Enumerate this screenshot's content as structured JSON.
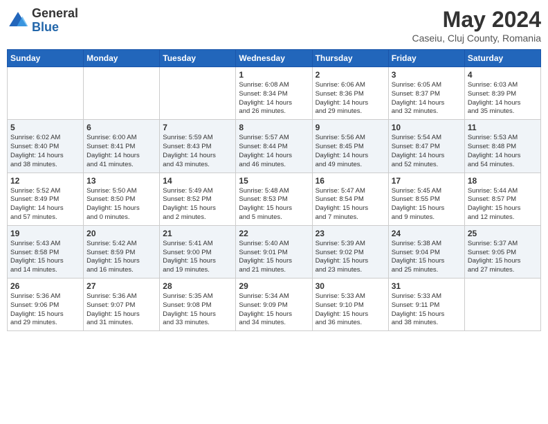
{
  "header": {
    "logo_general": "General",
    "logo_blue": "Blue",
    "main_title": "May 2024",
    "subtitle": "Caseiu, Cluj County, Romania"
  },
  "days_of_week": [
    "Sunday",
    "Monday",
    "Tuesday",
    "Wednesday",
    "Thursday",
    "Friday",
    "Saturday"
  ],
  "weeks": [
    [
      {
        "day": "",
        "info": ""
      },
      {
        "day": "",
        "info": ""
      },
      {
        "day": "",
        "info": ""
      },
      {
        "day": "1",
        "info": "Sunrise: 6:08 AM\nSunset: 8:34 PM\nDaylight: 14 hours\nand 26 minutes."
      },
      {
        "day": "2",
        "info": "Sunrise: 6:06 AM\nSunset: 8:36 PM\nDaylight: 14 hours\nand 29 minutes."
      },
      {
        "day": "3",
        "info": "Sunrise: 6:05 AM\nSunset: 8:37 PM\nDaylight: 14 hours\nand 32 minutes."
      },
      {
        "day": "4",
        "info": "Sunrise: 6:03 AM\nSunset: 8:39 PM\nDaylight: 14 hours\nand 35 minutes."
      }
    ],
    [
      {
        "day": "5",
        "info": "Sunrise: 6:02 AM\nSunset: 8:40 PM\nDaylight: 14 hours\nand 38 minutes."
      },
      {
        "day": "6",
        "info": "Sunrise: 6:00 AM\nSunset: 8:41 PM\nDaylight: 14 hours\nand 41 minutes."
      },
      {
        "day": "7",
        "info": "Sunrise: 5:59 AM\nSunset: 8:43 PM\nDaylight: 14 hours\nand 43 minutes."
      },
      {
        "day": "8",
        "info": "Sunrise: 5:57 AM\nSunset: 8:44 PM\nDaylight: 14 hours\nand 46 minutes."
      },
      {
        "day": "9",
        "info": "Sunrise: 5:56 AM\nSunset: 8:45 PM\nDaylight: 14 hours\nand 49 minutes."
      },
      {
        "day": "10",
        "info": "Sunrise: 5:54 AM\nSunset: 8:47 PM\nDaylight: 14 hours\nand 52 minutes."
      },
      {
        "day": "11",
        "info": "Sunrise: 5:53 AM\nSunset: 8:48 PM\nDaylight: 14 hours\nand 54 minutes."
      }
    ],
    [
      {
        "day": "12",
        "info": "Sunrise: 5:52 AM\nSunset: 8:49 PM\nDaylight: 14 hours\nand 57 minutes."
      },
      {
        "day": "13",
        "info": "Sunrise: 5:50 AM\nSunset: 8:50 PM\nDaylight: 15 hours\nand 0 minutes."
      },
      {
        "day": "14",
        "info": "Sunrise: 5:49 AM\nSunset: 8:52 PM\nDaylight: 15 hours\nand 2 minutes."
      },
      {
        "day": "15",
        "info": "Sunrise: 5:48 AM\nSunset: 8:53 PM\nDaylight: 15 hours\nand 5 minutes."
      },
      {
        "day": "16",
        "info": "Sunrise: 5:47 AM\nSunset: 8:54 PM\nDaylight: 15 hours\nand 7 minutes."
      },
      {
        "day": "17",
        "info": "Sunrise: 5:45 AM\nSunset: 8:55 PM\nDaylight: 15 hours\nand 9 minutes."
      },
      {
        "day": "18",
        "info": "Sunrise: 5:44 AM\nSunset: 8:57 PM\nDaylight: 15 hours\nand 12 minutes."
      }
    ],
    [
      {
        "day": "19",
        "info": "Sunrise: 5:43 AM\nSunset: 8:58 PM\nDaylight: 15 hours\nand 14 minutes."
      },
      {
        "day": "20",
        "info": "Sunrise: 5:42 AM\nSunset: 8:59 PM\nDaylight: 15 hours\nand 16 minutes."
      },
      {
        "day": "21",
        "info": "Sunrise: 5:41 AM\nSunset: 9:00 PM\nDaylight: 15 hours\nand 19 minutes."
      },
      {
        "day": "22",
        "info": "Sunrise: 5:40 AM\nSunset: 9:01 PM\nDaylight: 15 hours\nand 21 minutes."
      },
      {
        "day": "23",
        "info": "Sunrise: 5:39 AM\nSunset: 9:02 PM\nDaylight: 15 hours\nand 23 minutes."
      },
      {
        "day": "24",
        "info": "Sunrise: 5:38 AM\nSunset: 9:04 PM\nDaylight: 15 hours\nand 25 minutes."
      },
      {
        "day": "25",
        "info": "Sunrise: 5:37 AM\nSunset: 9:05 PM\nDaylight: 15 hours\nand 27 minutes."
      }
    ],
    [
      {
        "day": "26",
        "info": "Sunrise: 5:36 AM\nSunset: 9:06 PM\nDaylight: 15 hours\nand 29 minutes."
      },
      {
        "day": "27",
        "info": "Sunrise: 5:36 AM\nSunset: 9:07 PM\nDaylight: 15 hours\nand 31 minutes."
      },
      {
        "day": "28",
        "info": "Sunrise: 5:35 AM\nSunset: 9:08 PM\nDaylight: 15 hours\nand 33 minutes."
      },
      {
        "day": "29",
        "info": "Sunrise: 5:34 AM\nSunset: 9:09 PM\nDaylight: 15 hours\nand 34 minutes."
      },
      {
        "day": "30",
        "info": "Sunrise: 5:33 AM\nSunset: 9:10 PM\nDaylight: 15 hours\nand 36 minutes."
      },
      {
        "day": "31",
        "info": "Sunrise: 5:33 AM\nSunset: 9:11 PM\nDaylight: 15 hours\nand 38 minutes."
      },
      {
        "day": "",
        "info": ""
      }
    ]
  ]
}
